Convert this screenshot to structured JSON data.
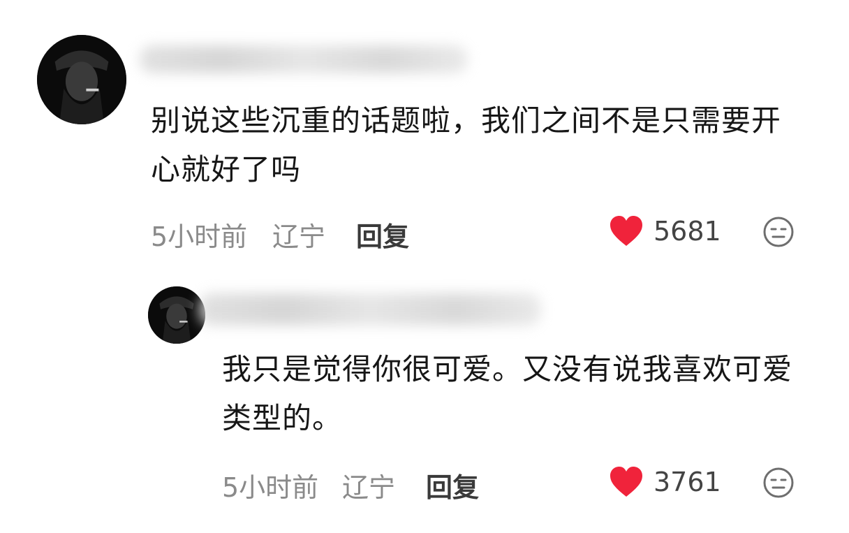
{
  "comments": [
    {
      "text": "别说这些沉重的话题啦，我们之间不是只需要开心就好了吗",
      "time": "5小时前",
      "location": "辽宁",
      "reply_label": "回复",
      "likes": "5681",
      "like_icon": "heart-icon",
      "dislike_icon": "neutral-face-icon",
      "accent_color": "#f0233b"
    },
    {
      "text": "我只是觉得你很可爱。又没有说我喜欢可爱类型的。",
      "time": "5小时前",
      "location": "辽宁",
      "reply_label": "回复",
      "likes": "3761",
      "like_icon": "heart-icon",
      "dislike_icon": "neutral-face-icon",
      "accent_color": "#f0233b"
    }
  ]
}
